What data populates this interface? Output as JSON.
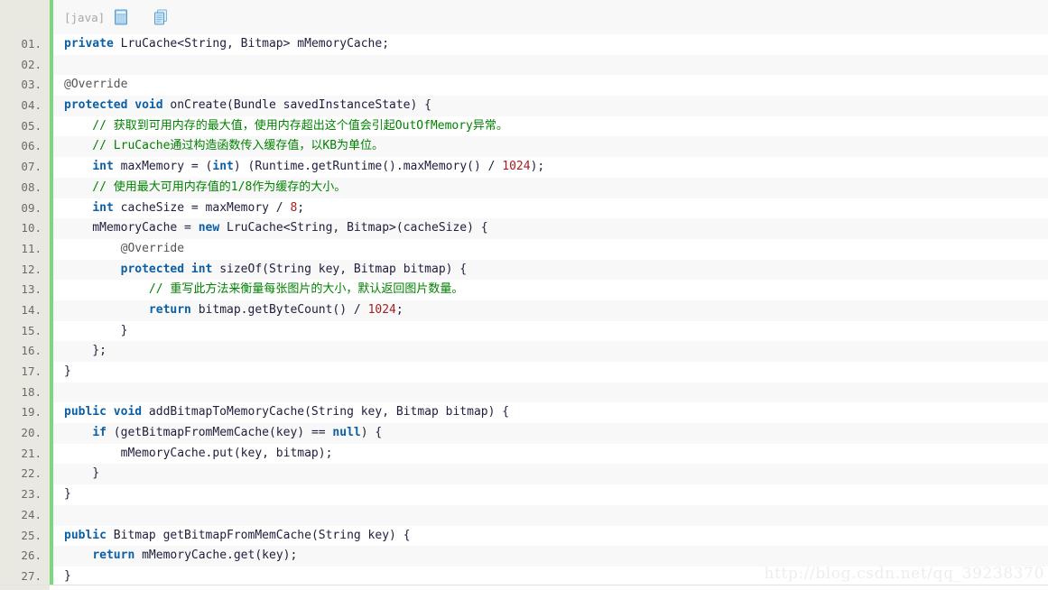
{
  "header": {
    "lang_label": "[java]",
    "icons": [
      {
        "name": "view-plain-icon",
        "title": "view plain"
      },
      {
        "name": "copy-icon",
        "title": "copy"
      }
    ]
  },
  "colors": {
    "gutter_bg": "#e9e9e1",
    "green_bar": "#7bd97b",
    "row_odd": "#ffffff",
    "row_even": "#f8f8f8",
    "keyword": "#0b5fa5",
    "comment": "#008200",
    "number": "#a52020",
    "plain": "#202040",
    "line_number": "#6b6b6b",
    "lang_label": "#a8a8a8",
    "watermark": "#ededed"
  },
  "code": {
    "language": "java",
    "line_numbers": [
      "01.",
      "02.",
      "03.",
      "04.",
      "05.",
      "06.",
      "07.",
      "08.",
      "09.",
      "10.",
      "11.",
      "12.",
      "13.",
      "14.",
      "15.",
      "16.",
      "17.",
      "18.",
      "19.",
      "20.",
      "21.",
      "22.",
      "23.",
      "24.",
      "25.",
      "26.",
      "27."
    ],
    "lines": [
      {
        "n": "01.",
        "text": "private LruCache<String, Bitmap> mMemoryCache;"
      },
      {
        "n": "02.",
        "text": ""
      },
      {
        "n": "03.",
        "text": "@Override"
      },
      {
        "n": "04.",
        "text": "protected void onCreate(Bundle savedInstanceState) {"
      },
      {
        "n": "05.",
        "text": "    // 获取到可用内存的最大值，使用内存超出这个值会引起OutOfMemory异常。"
      },
      {
        "n": "06.",
        "text": "    // LruCache通过构造函数传入缓存值，以KB为单位。"
      },
      {
        "n": "07.",
        "text": "    int maxMemory = (int) (Runtime.getRuntime().maxMemory() / 1024);"
      },
      {
        "n": "08.",
        "text": "    // 使用最大可用内存值的1/8作为缓存的大小。"
      },
      {
        "n": "09.",
        "text": "    int cacheSize = maxMemory / 8;"
      },
      {
        "n": "10.",
        "text": "    mMemoryCache = new LruCache<String, Bitmap>(cacheSize) {"
      },
      {
        "n": "11.",
        "text": "        @Override"
      },
      {
        "n": "12.",
        "text": "        protected int sizeOf(String key, Bitmap bitmap) {"
      },
      {
        "n": "13.",
        "text": "            // 重写此方法来衡量每张图片的大小，默认返回图片数量。"
      },
      {
        "n": "14.",
        "text": "            return bitmap.getByteCount() / 1024;"
      },
      {
        "n": "15.",
        "text": "        }"
      },
      {
        "n": "16.",
        "text": "    };"
      },
      {
        "n": "17.",
        "text": "}"
      },
      {
        "n": "18.",
        "text": ""
      },
      {
        "n": "19.",
        "text": "public void addBitmapToMemoryCache(String key, Bitmap bitmap) {"
      },
      {
        "n": "20.",
        "text": "    if (getBitmapFromMemCache(key) == null) {"
      },
      {
        "n": "21.",
        "text": "        mMemoryCache.put(key, bitmap);"
      },
      {
        "n": "22.",
        "text": "    }"
      },
      {
        "n": "23.",
        "text": "}"
      },
      {
        "n": "24.",
        "text": ""
      },
      {
        "n": "25.",
        "text": "public Bitmap getBitmapFromMemCache(String key) {"
      },
      {
        "n": "26.",
        "text": "    return mMemoryCache.get(key);"
      },
      {
        "n": "27.",
        "text": "}"
      }
    ],
    "tokens": [
      [
        {
          "t": "private",
          "c": "kw"
        },
        {
          "t": " LruCache<String, Bitmap> mMemoryCache;",
          "c": "pl"
        }
      ],
      [
        {
          "t": "",
          "c": "pl"
        }
      ],
      [
        {
          "t": "@Override",
          "c": "anno"
        }
      ],
      [
        {
          "t": "protected void",
          "c": "kw"
        },
        {
          "t": " onCreate(Bundle savedInstanceState) {",
          "c": "pl"
        }
      ],
      [
        {
          "t": "    // 获取到可用内存的最大值，使用内存超出这个值会引起OutOfMemory异常。",
          "c": "cm"
        }
      ],
      [
        {
          "t": "    // LruCache通过构造函数传入缓存值，以KB为单位。",
          "c": "cm"
        }
      ],
      [
        {
          "t": "    ",
          "c": "pl"
        },
        {
          "t": "int",
          "c": "kw"
        },
        {
          "t": " maxMemory = (",
          "c": "pl"
        },
        {
          "t": "int",
          "c": "kw"
        },
        {
          "t": ") (Runtime.getRuntime().maxMemory() / ",
          "c": "pl"
        },
        {
          "t": "1024",
          "c": "num"
        },
        {
          "t": ");",
          "c": "pl"
        }
      ],
      [
        {
          "t": "    // 使用最大可用内存值的1/8作为缓存的大小。",
          "c": "cm"
        }
      ],
      [
        {
          "t": "    ",
          "c": "pl"
        },
        {
          "t": "int",
          "c": "kw"
        },
        {
          "t": " cacheSize = maxMemory / ",
          "c": "pl"
        },
        {
          "t": "8",
          "c": "num"
        },
        {
          "t": ";",
          "c": "pl"
        }
      ],
      [
        {
          "t": "    mMemoryCache = ",
          "c": "pl"
        },
        {
          "t": "new",
          "c": "kw"
        },
        {
          "t": " LruCache<String, Bitmap>(cacheSize) {",
          "c": "pl"
        }
      ],
      [
        {
          "t": "        @Override",
          "c": "anno"
        }
      ],
      [
        {
          "t": "        ",
          "c": "pl"
        },
        {
          "t": "protected int",
          "c": "kw"
        },
        {
          "t": " sizeOf(String key, Bitmap bitmap) {",
          "c": "pl"
        }
      ],
      [
        {
          "t": "            // 重写此方法来衡量每张图片的大小，默认返回图片数量。",
          "c": "cm"
        }
      ],
      [
        {
          "t": "            ",
          "c": "pl"
        },
        {
          "t": "return",
          "c": "kw"
        },
        {
          "t": " bitmap.getByteCount() / ",
          "c": "pl"
        },
        {
          "t": "1024",
          "c": "num"
        },
        {
          "t": ";",
          "c": "pl"
        }
      ],
      [
        {
          "t": "        }",
          "c": "pl"
        }
      ],
      [
        {
          "t": "    };",
          "c": "pl"
        }
      ],
      [
        {
          "t": "}",
          "c": "pl"
        }
      ],
      [
        {
          "t": "",
          "c": "pl"
        }
      ],
      [
        {
          "t": "public void",
          "c": "kw"
        },
        {
          "t": " addBitmapToMemoryCache(String key, Bitmap bitmap) {",
          "c": "pl"
        }
      ],
      [
        {
          "t": "    ",
          "c": "pl"
        },
        {
          "t": "if",
          "c": "kw"
        },
        {
          "t": " (getBitmapFromMemCache(key) == ",
          "c": "pl"
        },
        {
          "t": "null",
          "c": "kw"
        },
        {
          "t": ") {",
          "c": "pl"
        }
      ],
      [
        {
          "t": "        mMemoryCache.put(key, bitmap);",
          "c": "pl"
        }
      ],
      [
        {
          "t": "    }",
          "c": "pl"
        }
      ],
      [
        {
          "t": "}",
          "c": "pl"
        }
      ],
      [
        {
          "t": "",
          "c": "pl"
        }
      ],
      [
        {
          "t": "public",
          "c": "kw"
        },
        {
          "t": " Bitmap getBitmapFromMemCache(String key) {",
          "c": "pl"
        }
      ],
      [
        {
          "t": "    ",
          "c": "pl"
        },
        {
          "t": "return",
          "c": "kw"
        },
        {
          "t": " mMemoryCache.get(key);",
          "c": "pl"
        }
      ],
      [
        {
          "t": "}",
          "c": "pl"
        }
      ]
    ]
  },
  "watermark": {
    "text": "http://blog.csdn.net/qq_39238370"
  }
}
